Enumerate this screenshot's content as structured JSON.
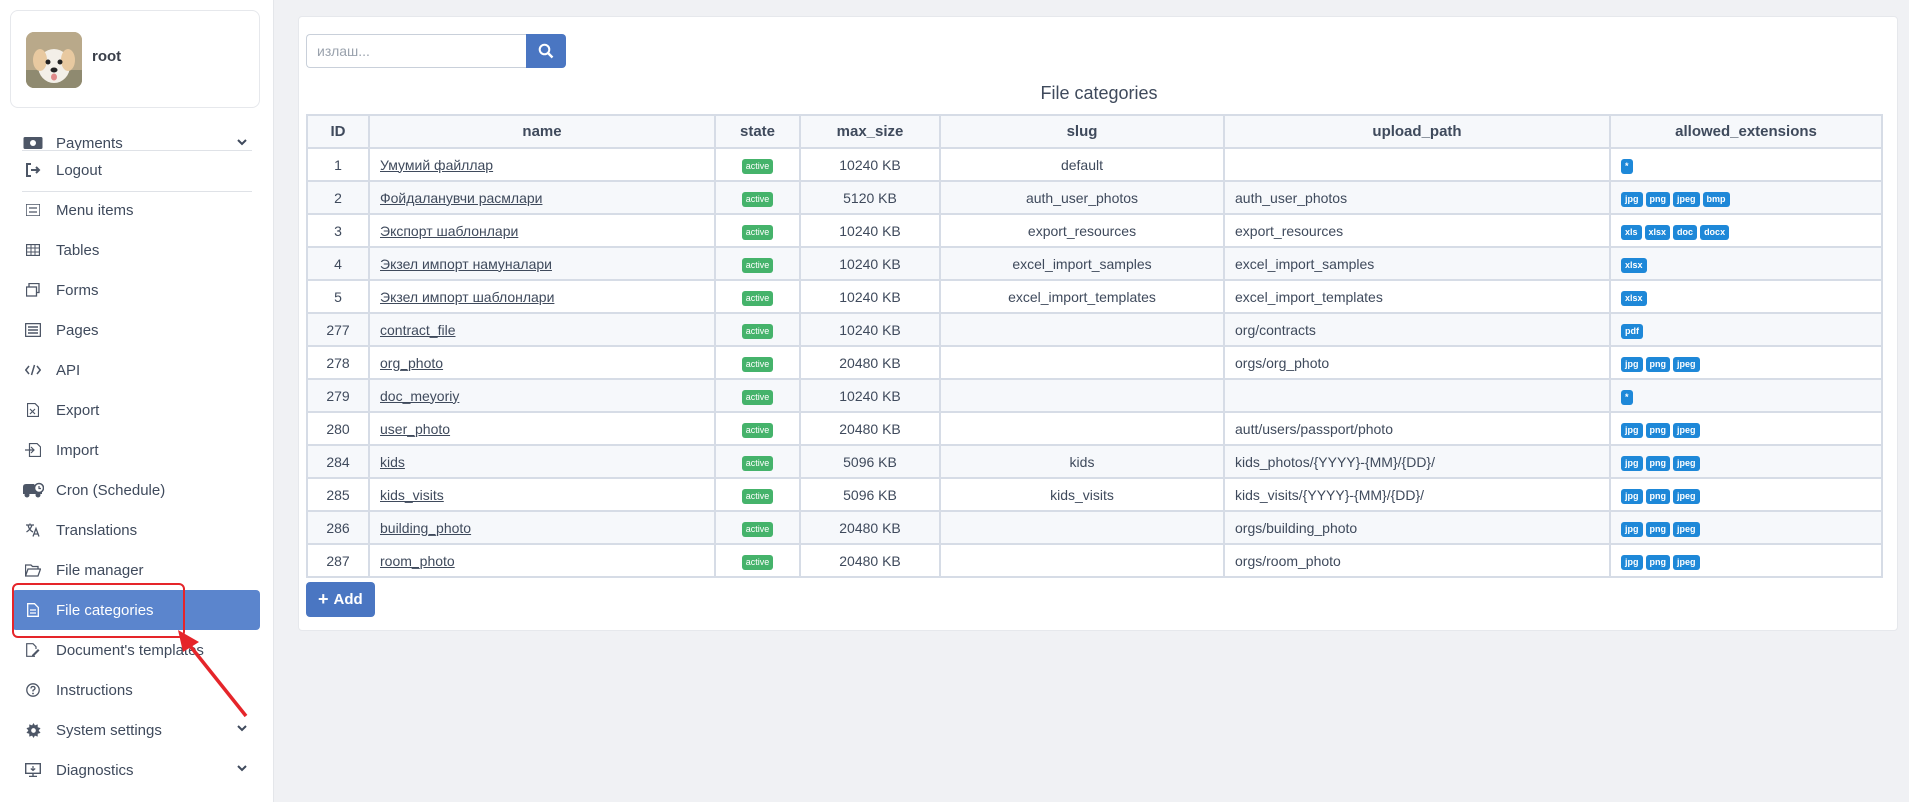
{
  "user": {
    "name": "root"
  },
  "sidebar": {
    "items": [
      {
        "label": "Payments",
        "icon": "money-icon"
      },
      {
        "label": "Logout",
        "icon": "logout-icon"
      },
      {
        "label": "Menu items",
        "icon": "list-icon"
      },
      {
        "label": "Tables",
        "icon": "table-icon"
      },
      {
        "label": "Forms",
        "icon": "forms-icon"
      },
      {
        "label": "Pages",
        "icon": "pages-icon"
      },
      {
        "label": "API",
        "icon": "code-icon"
      },
      {
        "label": "Export",
        "icon": "export-icon"
      },
      {
        "label": "Import",
        "icon": "import-icon"
      },
      {
        "label": "Cron (Schedule)",
        "icon": "cron-icon"
      },
      {
        "label": "Translations",
        "icon": "translate-icon"
      },
      {
        "label": "File manager",
        "icon": "folder-icon"
      },
      {
        "label": "File categories",
        "icon": "file-icon"
      },
      {
        "label": "Document's templates",
        "icon": "document-edit-icon"
      },
      {
        "label": "Instructions",
        "icon": "question-icon"
      },
      {
        "label": "System settings",
        "icon": "gear-icon"
      },
      {
        "label": "Diagnostics",
        "icon": "monitor-icon"
      }
    ],
    "active": "File categories"
  },
  "search": {
    "placeholder": "излаш..."
  },
  "table": {
    "title": "File categories",
    "headers": [
      "ID",
      "name",
      "state",
      "max_size",
      "slug",
      "upload_path",
      "allowed_extensions"
    ],
    "rows": [
      {
        "id": "1",
        "name": "Умумий файллар",
        "state": "active",
        "max_size": "10240 KB",
        "slug": "default",
        "upload_path": "",
        "ext": [
          "*"
        ]
      },
      {
        "id": "2",
        "name": "Фойдаланувчи расмлари",
        "state": "active",
        "max_size": "5120 KB",
        "slug": "auth_user_photos",
        "upload_path": "auth_user_photos",
        "ext": [
          "jpg",
          "png",
          "jpeg",
          "bmp"
        ]
      },
      {
        "id": "3",
        "name": "Экспорт шаблонлари",
        "state": "active",
        "max_size": "10240 KB",
        "slug": "export_resources",
        "upload_path": "export_resources",
        "ext": [
          "xls",
          "xlsx",
          "doc",
          "docx"
        ]
      },
      {
        "id": "4",
        "name": "Экзел импорт намуналари",
        "state": "active",
        "max_size": "10240 KB",
        "slug": "excel_import_samples",
        "upload_path": "excel_import_samples",
        "ext": [
          "xlsx"
        ]
      },
      {
        "id": "5",
        "name": "Экзел импорт шаблонлари",
        "state": "active",
        "max_size": "10240 KB",
        "slug": "excel_import_templates",
        "upload_path": "excel_import_templates",
        "ext": [
          "xlsx"
        ]
      },
      {
        "id": "277",
        "name": "contract_file",
        "state": "active",
        "max_size": "10240 KB",
        "slug": "",
        "upload_path": "org/contracts",
        "ext": [
          "pdf"
        ]
      },
      {
        "id": "278",
        "name": "org_photo",
        "state": "active",
        "max_size": "20480 KB",
        "slug": "",
        "upload_path": "orgs/org_photo",
        "ext": [
          "jpg",
          "png",
          "jpeg"
        ]
      },
      {
        "id": "279",
        "name": "doc_meyoriy",
        "state": "active",
        "max_size": "10240 KB",
        "slug": "",
        "upload_path": "",
        "ext": [
          "*"
        ]
      },
      {
        "id": "280",
        "name": "user_photo",
        "state": "active",
        "max_size": "20480 KB",
        "slug": "",
        "upload_path": "autt/users/passport/photo",
        "ext": [
          "jpg",
          "png",
          "jpeg"
        ]
      },
      {
        "id": "284",
        "name": "kids",
        "state": "active",
        "max_size": "5096 KB",
        "slug": "kids",
        "upload_path": "kids_photos/{YYYY}-{MM}/{DD}/",
        "ext": [
          "jpg",
          "png",
          "jpeg"
        ]
      },
      {
        "id": "285",
        "name": "kids_visits",
        "state": "active",
        "max_size": "5096 KB",
        "slug": "kids_visits",
        "upload_path": "kids_visits/{YYYY}-{MM}/{DD}/",
        "ext": [
          "jpg",
          "png",
          "jpeg"
        ]
      },
      {
        "id": "286",
        "name": "building_photo",
        "state": "active",
        "max_size": "20480 KB",
        "slug": "",
        "upload_path": "orgs/building_photo",
        "ext": [
          "jpg",
          "png",
          "jpeg"
        ]
      },
      {
        "id": "287",
        "name": "room_photo",
        "state": "active",
        "max_size": "20480 KB",
        "slug": "",
        "upload_path": "orgs/room_photo",
        "ext": [
          "jpg",
          "png",
          "jpeg"
        ]
      }
    ]
  },
  "actions": {
    "add_label": "Add"
  },
  "colors": {
    "accent": "#4a76c2",
    "active_nav": "#5b85cd",
    "badge_active": "#45b36b",
    "ext_badge": "#1e88d8",
    "annotation": "#e5252a"
  }
}
